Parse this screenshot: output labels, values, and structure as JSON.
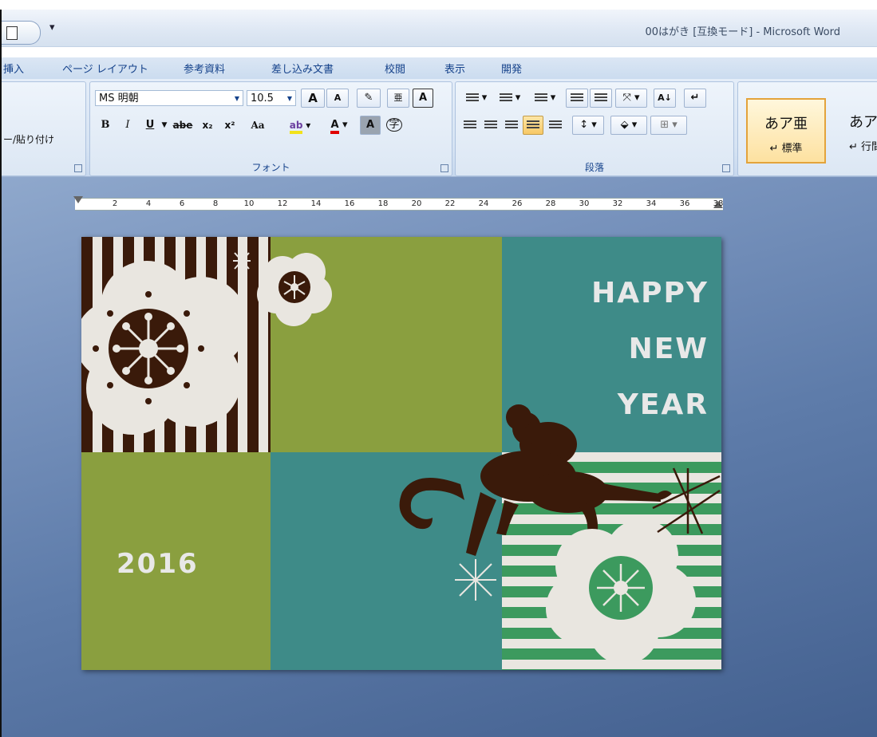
{
  "title_bar": {
    "title": "00はがき [互換モード] - Microsoft Word",
    "qat_more": "▾"
  },
  "tabs": [
    "挿入",
    "ページ レイアウト",
    "参考資料",
    "差し込み文書",
    "校閲",
    "表示",
    "開発"
  ],
  "clipboard": {
    "paste_label": "ー/貼り付け"
  },
  "font_group": {
    "label": "フォント",
    "font_name": "MS 明朝",
    "font_size": "10.5",
    "grow_label": "A",
    "shrink_label": "A",
    "bold": "B",
    "italic": "I",
    "underline": "U",
    "strike": "abe",
    "subscript": "x₂",
    "superscript": "x²",
    "change_case": "Aa",
    "char_border": "A",
    "char_shading": "A",
    "enclose": "字"
  },
  "paragraph_group": {
    "label": "段落"
  },
  "styles": [
    {
      "sample": "あア亜",
      "name": "↵ 標準"
    },
    {
      "sample": "あア亜",
      "name": "↵ 行間詰"
    }
  ],
  "ruler": {
    "numbers": [
      "2",
      "4",
      "6",
      "8",
      "10",
      "12",
      "14",
      "16",
      "18",
      "20",
      "22",
      "24",
      "26",
      "28",
      "30",
      "32",
      "34",
      "36",
      "38"
    ]
  },
  "card": {
    "greeting": [
      "HAPPY",
      "NEW",
      "YEAR"
    ],
    "year": "2016"
  },
  "colors": {
    "olive": "#8a9f3f",
    "teal": "#3e8b88",
    "brown": "#3a1a0a",
    "cream": "#e9e6e0",
    "green": "#3c9a5e"
  }
}
